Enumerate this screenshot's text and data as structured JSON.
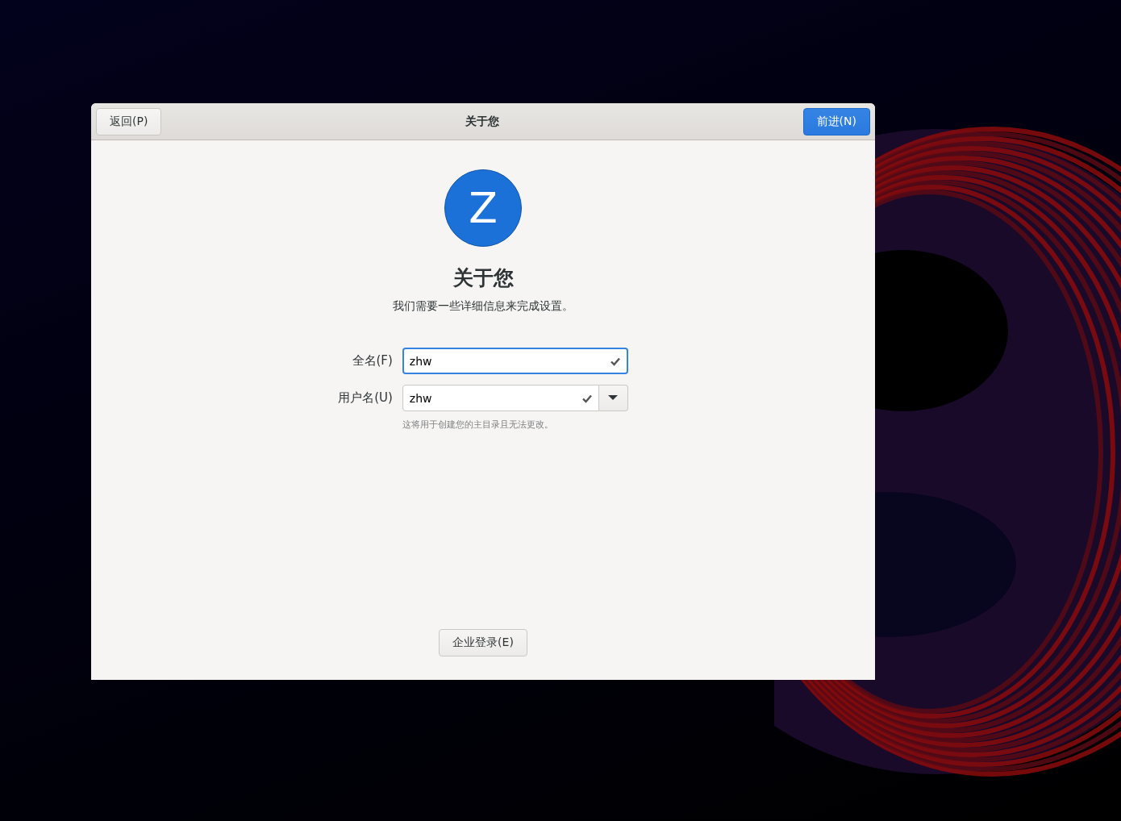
{
  "window": {
    "title": "关于您",
    "back_button": "返回(P)",
    "next_button": "前进(N)"
  },
  "avatar": {
    "letter": "Z"
  },
  "heading": "关于您",
  "subtitle": "我们需要一些详细信息来完成设置。",
  "fields": [
    {
      "kind": "entry",
      "label": "全名(F)",
      "value": "zhw",
      "focused": true,
      "valid": true
    },
    {
      "kind": "combo",
      "label": "用户名(U)",
      "value": "zhw",
      "focused": false,
      "valid": true
    }
  ],
  "hint": "这将用于创建您的主目录且无法更改。",
  "enterprise_button": "企业登录(E)"
}
